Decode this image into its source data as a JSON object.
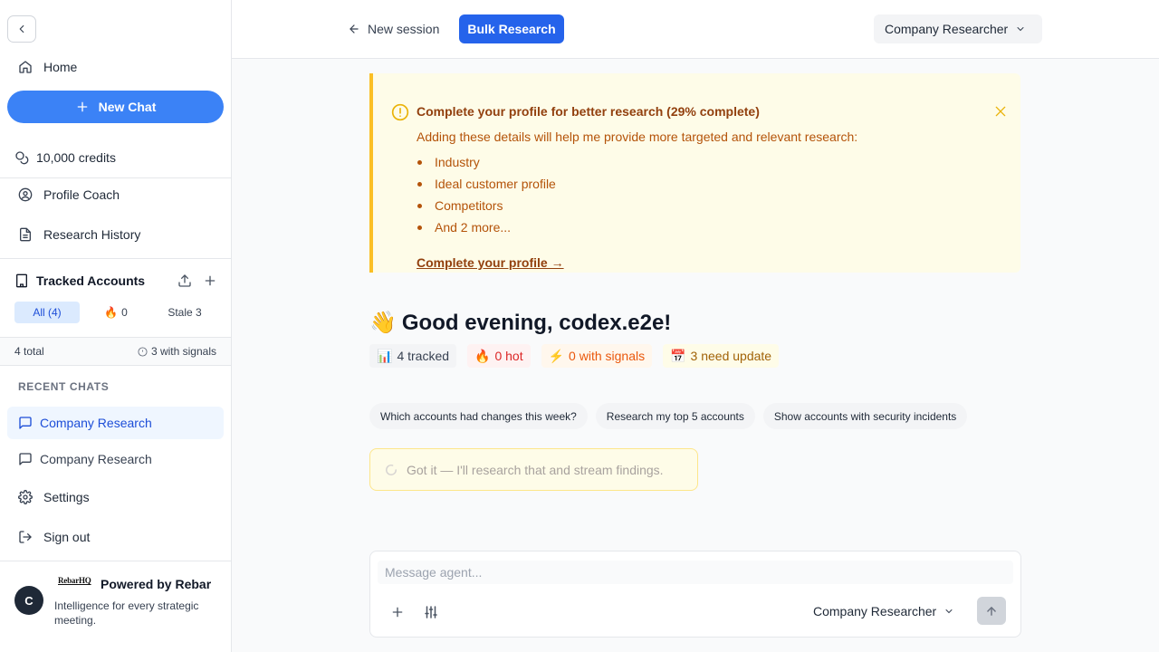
{
  "sidebar": {
    "home_label": "Home",
    "new_chat_label": "New Chat",
    "credits_label": "10,000 credits",
    "profile_coach_label": "Profile Coach",
    "research_history_label": "Research History",
    "tracked": {
      "title": "Tracked Accounts",
      "tabs": [
        {
          "label": "All (4)",
          "active": true
        },
        {
          "label": "0",
          "icon": "🔥"
        },
        {
          "label": "Stale 3"
        }
      ],
      "total_label": "4 total",
      "signals_label": "3 with signals"
    },
    "recent_chats_label": "RECENT CHATS",
    "recent_chats": [
      {
        "label": "Company Research",
        "active": true
      },
      {
        "label": "Company Research",
        "active": false
      }
    ],
    "settings_label": "Settings",
    "sign_out_label": "Sign out",
    "footer": {
      "avatar_letter": "C",
      "logo_text": "RebarHQ",
      "powered_by": "Powered by Rebar",
      "tagline": "Intelligence for every strategic meeting."
    }
  },
  "topbar": {
    "new_session_label": "New session",
    "bulk_research_label": "Bulk Research",
    "agent_selected": "Company Researcher"
  },
  "banner": {
    "title": "Complete your profile for better research (29% complete)",
    "description": "Adding these details will help me provide more targeted and relevant research:",
    "items": [
      "Industry",
      "Ideal customer profile",
      "Competitors",
      "And 2 more..."
    ],
    "link_label": "Complete your profile →"
  },
  "greeting": {
    "emoji": "👋",
    "text": "Good evening, codex.e2e!"
  },
  "stats": {
    "tracked": {
      "emoji": "📊",
      "label": "4 tracked"
    },
    "hot": {
      "emoji": "🔥",
      "label": "0 hot"
    },
    "signals": {
      "emoji": "⚡",
      "label": "0 with signals"
    },
    "update": {
      "emoji": "📅",
      "label": "3 need update"
    }
  },
  "suggestions": [
    "Which accounts had changes this week?",
    "Research my top 5 accounts",
    "Show accounts with security incidents"
  ],
  "status_message": "Got it — I'll research that and stream findings.",
  "composer": {
    "placeholder": "Message agent...",
    "value": "",
    "agent_selected": "Company Researcher"
  },
  "colors": {
    "primary": "#2563eb",
    "new_chat": "#3b82f6",
    "banner_bg": "#fefce8",
    "banner_accent": "#fbbf24",
    "banner_text": "#b45309"
  }
}
